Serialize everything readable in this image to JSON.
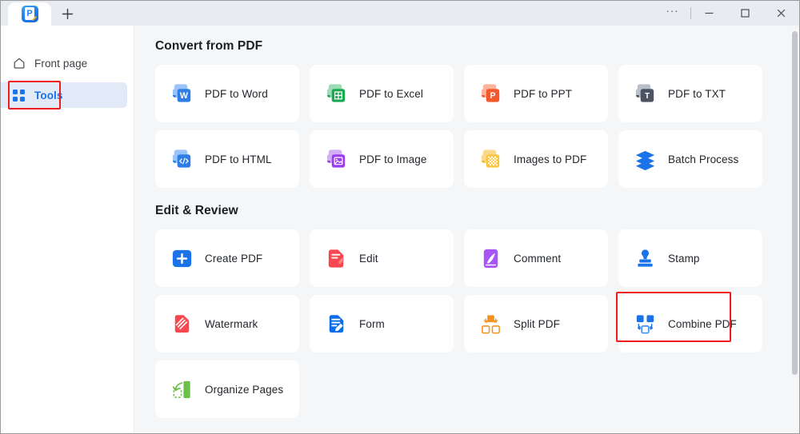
{
  "window": {
    "tab_icon": "app-logo-icon",
    "new_tab_label": "+",
    "controls": {
      "more_label": "···",
      "minimize_label": "─",
      "maximize_label": "☐",
      "close_label": "✕"
    }
  },
  "sidebar": {
    "items": [
      {
        "label": "Front page",
        "icon": "home-icon",
        "selected": false
      },
      {
        "label": "Tools",
        "icon": "grid-icon",
        "selected": true
      }
    ]
  },
  "sections": [
    {
      "title": "Convert from PDF",
      "cards": [
        {
          "label": "PDF to Word",
          "icon": "pdf-to-word-icon"
        },
        {
          "label": "PDF to Excel",
          "icon": "pdf-to-excel-icon"
        },
        {
          "label": "PDF to PPT",
          "icon": "pdf-to-ppt-icon"
        },
        {
          "label": "PDF to TXT",
          "icon": "pdf-to-txt-icon"
        },
        {
          "label": "PDF to HTML",
          "icon": "pdf-to-html-icon"
        },
        {
          "label": "PDF to Image",
          "icon": "pdf-to-image-icon"
        },
        {
          "label": "Images to PDF",
          "icon": "images-to-pdf-icon"
        },
        {
          "label": "Batch Process",
          "icon": "batch-process-icon"
        }
      ]
    },
    {
      "title": "Edit & Review",
      "cards": [
        {
          "label": "Create PDF",
          "icon": "create-pdf-icon"
        },
        {
          "label": "Edit",
          "icon": "edit-icon"
        },
        {
          "label": "Comment",
          "icon": "comment-icon"
        },
        {
          "label": "Stamp",
          "icon": "stamp-icon"
        },
        {
          "label": "Watermark",
          "icon": "watermark-icon"
        },
        {
          "label": "Form",
          "icon": "form-icon"
        },
        {
          "label": "Split PDF",
          "icon": "split-pdf-icon"
        },
        {
          "label": "Combine PDF",
          "icon": "combine-pdf-icon",
          "highlighted": true
        },
        {
          "label": "Organize Pages",
          "icon": "organize-pages-icon"
        }
      ]
    }
  ],
  "colors": {
    "accent": "#1a73e8",
    "highlight": "#ee1c1c",
    "selected_nav_bg": "#e3eaf7",
    "content_bg": "#f5f6f8",
    "card_bg": "#ffffff"
  }
}
